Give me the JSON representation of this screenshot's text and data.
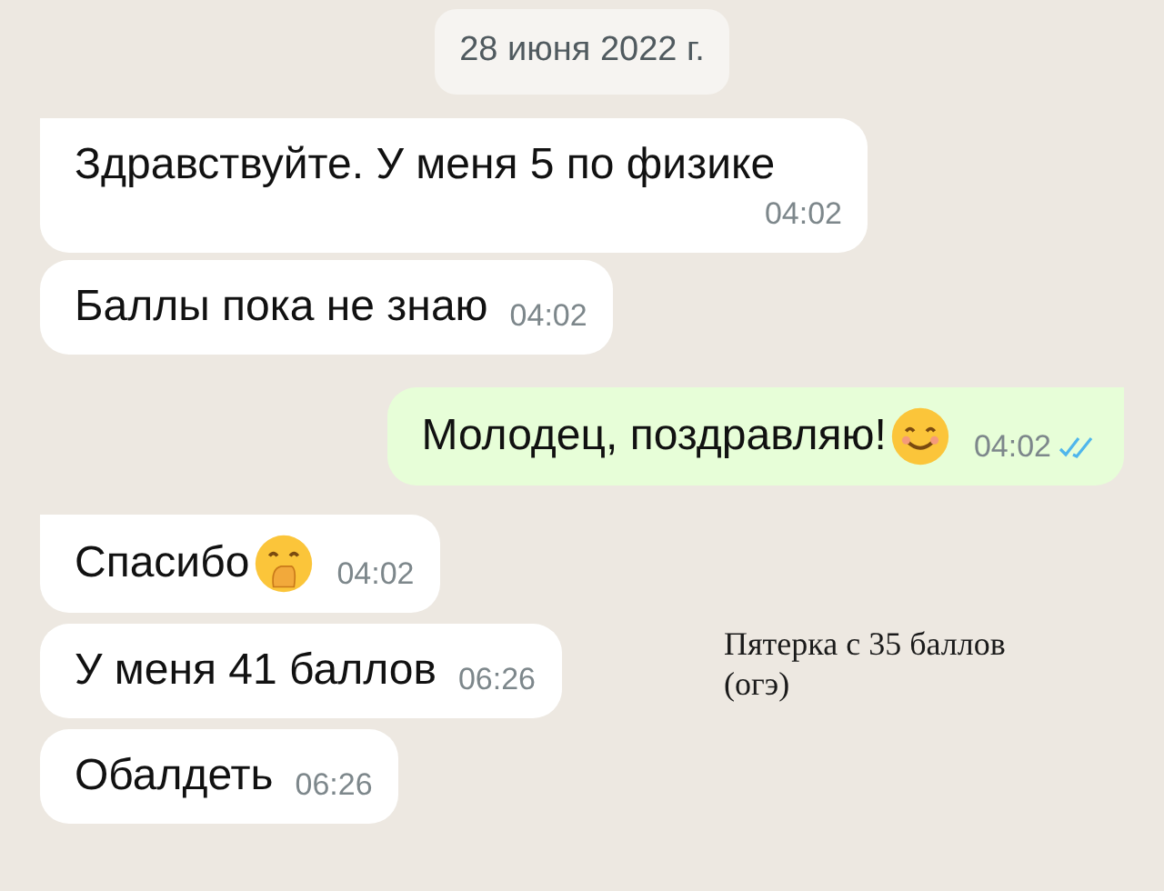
{
  "date_divider": "28 июня 2022 г.",
  "messages": [
    {
      "kind": "text",
      "text": "Здравствуйте. У меня 5 по физике",
      "time": "04:02",
      "outgoing": false,
      "tail": true
    },
    {
      "kind": "text",
      "text": "Баллы пока не знаю",
      "time": "04:02",
      "outgoing": false,
      "tail": false
    },
    {
      "kind": "smile",
      "text": "Молодец, поздравляю!",
      "time": "04:02",
      "outgoing": true,
      "tail": true,
      "read": true
    },
    {
      "kind": "giggle",
      "text": "Спасибо",
      "time": "04:02",
      "outgoing": false,
      "tail": true
    },
    {
      "kind": "text",
      "text": "У меня 41 баллов",
      "time": "06:26",
      "outgoing": false,
      "tail": false
    },
    {
      "kind": "text",
      "text": "Обалдеть",
      "time": "06:26",
      "outgoing": false,
      "tail": false
    }
  ],
  "annotation": "Пятерка с 35 баллов (огэ)"
}
